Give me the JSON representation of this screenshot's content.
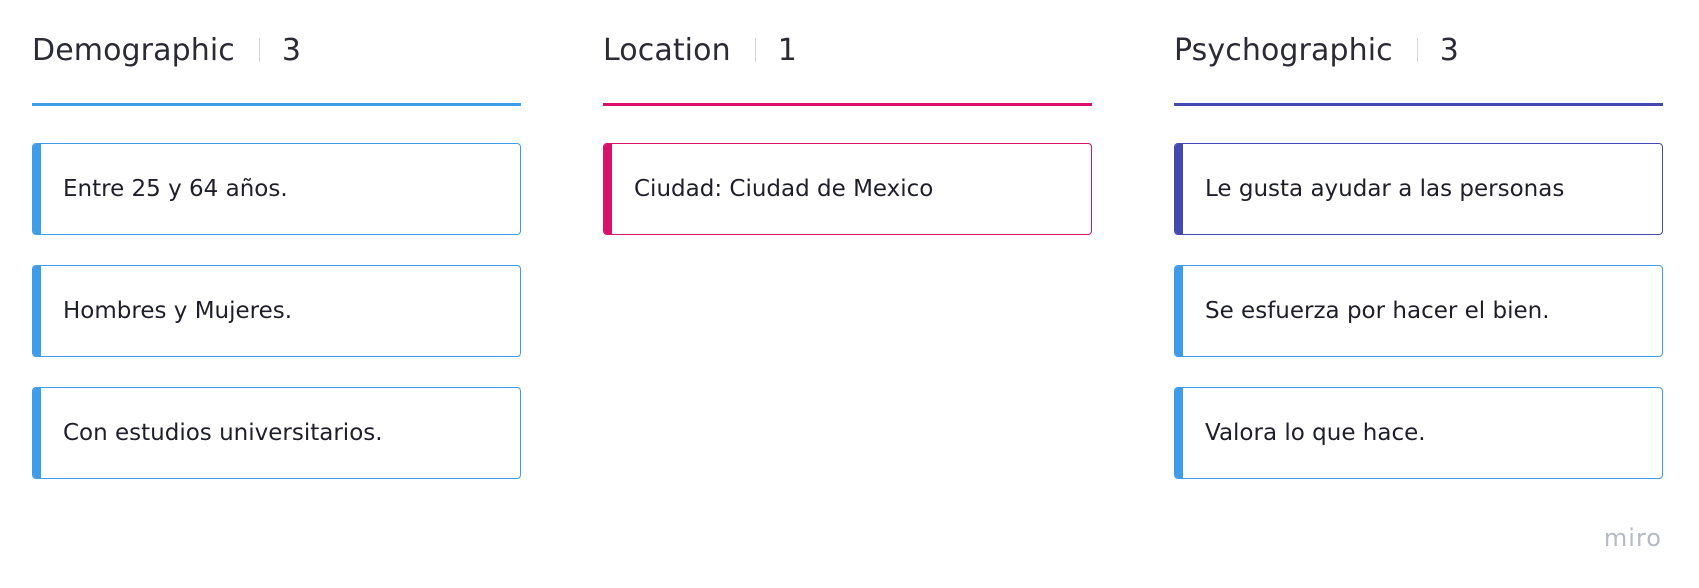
{
  "colors": {
    "blue": "#3e9ce8",
    "pink": "#d9116a",
    "indigo": "#4449b0"
  },
  "columns": [
    {
      "title": "Demographic",
      "count": "3",
      "accent": "#3e9ce8",
      "cards": [
        {
          "text": "Entre 25 y 64 años.",
          "color": "#3e9ce8"
        },
        {
          "text": "Hombres y Mujeres.",
          "color": "#3e9ce8"
        },
        {
          "text": "Con estudios universitarios.",
          "color": "#3e9ce8"
        }
      ]
    },
    {
      "title": "Location",
      "count": "1",
      "accent": "#d9116a",
      "cards": [
        {
          "text": "Ciudad: Ciudad de Mexico",
          "color": "#d9116a"
        }
      ]
    },
    {
      "title": "Psychographic",
      "count": "3",
      "accent": "#4449b0",
      "cards": [
        {
          "text": "Le gusta ayudar a las personas",
          "color": "#4449b0"
        },
        {
          "text": "Se esfuerza por hacer el bien.",
          "color": "#3e9ce8"
        },
        {
          "text": "Valora lo que hace.",
          "color": "#3e9ce8"
        }
      ]
    }
  ],
  "watermark": "miro"
}
